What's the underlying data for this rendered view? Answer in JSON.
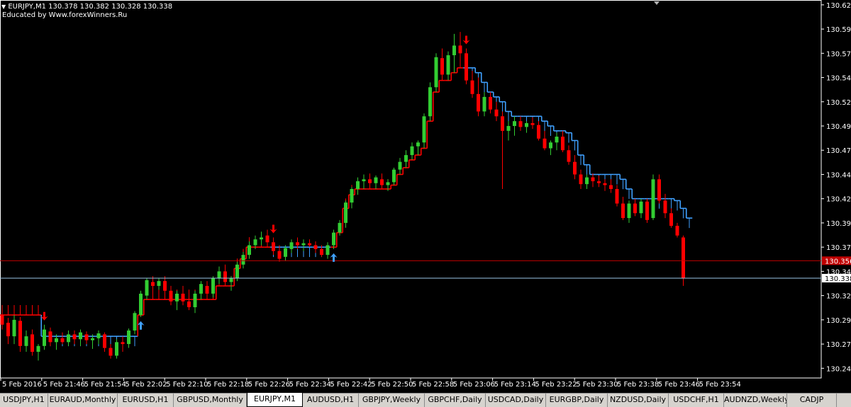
{
  "header": {
    "title": "EURJPY,M1  130.378 130.382 130.328 130.338",
    "subtitle": "Educated by Www.forexWinners.Ru"
  },
  "price_axis": {
    "labels": [
      "130.620",
      "130.595",
      "130.570",
      "130.545",
      "130.520",
      "130.495",
      "130.470",
      "130.445",
      "130.420",
      "130.395",
      "130.370",
      "130.345",
      "130.320",
      "130.295",
      "130.270",
      "130.245"
    ],
    "bid_line_label": "130.338",
    "red_line_label": "130.356"
  },
  "time_axis": {
    "labels": [
      "5 Feb 2016",
      "5 Feb 21:46",
      "5 Feb 21:54",
      "5 Feb 22:02",
      "5 Feb 22:10",
      "5 Feb 22:18",
      "5 Feb 22:26",
      "5 Feb 22:34",
      "5 Feb 22:42",
      "5 Feb 22:50",
      "5 Feb 22:58",
      "5 Feb 23:06",
      "5 Feb 23:14",
      "5 Feb 23:22",
      "5 Feb 23:30",
      "5 Feb 23:38",
      "5 Feb 23:46",
      "5 Feb 23:54"
    ]
  },
  "colors": {
    "background": "#000000",
    "bull_candle": "#32cd32",
    "bear_candle": "#ff0000",
    "trail_up": "#3fa0ff",
    "trail_down": "#ff0000",
    "bid_line": "#9ac6e8",
    "red_line": "#c00000",
    "axis": "#ffffff"
  },
  "chart_data": {
    "type": "candlestick",
    "symbol": "EURJPY",
    "timeframe": "M1",
    "ylim": [
      130.235,
      130.625
    ],
    "candles": [
      [
        130.3,
        130.306,
        130.285,
        130.29
      ],
      [
        130.292,
        130.297,
        130.27,
        130.278
      ],
      [
        130.278,
        130.3,
        130.27,
        130.295
      ],
      [
        130.294,
        130.298,
        130.262,
        130.268
      ],
      [
        130.268,
        130.284,
        130.262,
        130.278
      ],
      [
        130.28,
        130.285,
        130.258,
        130.262
      ],
      [
        130.262,
        130.27,
        130.253,
        130.268
      ],
      [
        130.268,
        130.29,
        130.264,
        130.285
      ],
      [
        130.283,
        130.287,
        130.268,
        130.272
      ],
      [
        130.272,
        130.28,
        130.264,
        130.276
      ],
      [
        130.276,
        130.282,
        130.27,
        130.272
      ],
      [
        130.272,
        130.284,
        130.268,
        130.28
      ],
      [
        130.28,
        130.284,
        130.27,
        130.275
      ],
      [
        130.275,
        130.285,
        130.268,
        130.282
      ],
      [
        130.28,
        130.283,
        130.27,
        130.274
      ],
      [
        130.274,
        130.28,
        130.265,
        130.276
      ],
      [
        130.276,
        130.284,
        130.27,
        130.281
      ],
      [
        130.28,
        130.282,
        130.262,
        130.266
      ],
      [
        130.266,
        130.27,
        130.255,
        130.258
      ],
      [
        130.258,
        130.275,
        130.255,
        130.272
      ],
      [
        130.272,
        130.278,
        130.262,
        130.27
      ],
      [
        130.27,
        130.286,
        130.266,
        130.284
      ],
      [
        130.284,
        130.304,
        130.28,
        130.302
      ],
      [
        130.3,
        130.325,
        130.298,
        130.322
      ],
      [
        130.32,
        130.338,
        130.316,
        130.336
      ],
      [
        130.334,
        130.34,
        130.325,
        130.33
      ],
      [
        130.33,
        130.338,
        130.326,
        130.335
      ],
      [
        130.335,
        130.34,
        130.32,
        130.325
      ],
      [
        130.325,
        130.33,
        130.31,
        130.314
      ],
      [
        130.314,
        130.325,
        130.305,
        130.322
      ],
      [
        130.322,
        130.33,
        130.31,
        130.314
      ],
      [
        130.314,
        130.32,
        130.305,
        130.308
      ],
      [
        130.308,
        130.325,
        130.302,
        130.322
      ],
      [
        130.322,
        130.335,
        130.316,
        130.332
      ],
      [
        130.33,
        130.335,
        130.318,
        130.322
      ],
      [
        130.322,
        130.34,
        130.318,
        130.338
      ],
      [
        130.338,
        130.35,
        130.332,
        130.345
      ],
      [
        130.345,
        130.352,
        130.33,
        130.334
      ],
      [
        130.334,
        130.34,
        130.325,
        130.338
      ],
      [
        130.338,
        130.355,
        130.335,
        130.352
      ],
      [
        130.352,
        130.365,
        130.348,
        130.362
      ],
      [
        130.362,
        130.376,
        130.358,
        130.372
      ],
      [
        130.372,
        130.382,
        130.368,
        130.378
      ],
      [
        130.378,
        130.386,
        130.372,
        130.38
      ],
      [
        130.382,
        130.388,
        130.372,
        130.375
      ],
      [
        130.375,
        130.38,
        130.362,
        130.366
      ],
      [
        130.366,
        130.372,
        130.355,
        130.358
      ],
      [
        130.36,
        130.372,
        130.356,
        130.369
      ],
      [
        130.368,
        130.378,
        130.364,
        130.375
      ],
      [
        130.375,
        130.38,
        130.368,
        130.372
      ],
      [
        130.372,
        130.378,
        130.366,
        130.374
      ],
      [
        130.374,
        130.378,
        130.37,
        130.372
      ],
      [
        130.372,
        130.376,
        130.364,
        130.368
      ],
      [
        130.368,
        130.372,
        130.36,
        130.362
      ],
      [
        130.362,
        130.375,
        130.358,
        130.372
      ],
      [
        130.372,
        130.388,
        130.368,
        130.385
      ],
      [
        130.385,
        130.398,
        130.382,
        130.395
      ],
      [
        130.395,
        130.418,
        130.39,
        130.416
      ],
      [
        130.416,
        130.432,
        130.41,
        130.43
      ],
      [
        130.43,
        130.442,
        130.424,
        130.438
      ],
      [
        130.438,
        130.445,
        130.43,
        130.44
      ],
      [
        130.44,
        130.446,
        130.432,
        130.436
      ],
      [
        130.436,
        130.444,
        130.43,
        130.442
      ],
      [
        130.44,
        130.446,
        130.43,
        130.434
      ],
      [
        130.434,
        130.44,
        130.428,
        130.437
      ],
      [
        130.437,
        130.452,
        130.434,
        130.45
      ],
      [
        130.45,
        130.462,
        130.445,
        130.458
      ],
      [
        130.458,
        130.47,
        130.452,
        130.465
      ],
      [
        130.465,
        130.478,
        130.46,
        130.474
      ],
      [
        130.474,
        130.48,
        130.465,
        130.478
      ],
      [
        130.478,
        130.508,
        130.472,
        130.505
      ],
      [
        130.505,
        130.54,
        130.5,
        130.535
      ],
      [
        130.535,
        130.57,
        130.53,
        130.566
      ],
      [
        130.565,
        130.575,
        130.542,
        130.548
      ],
      [
        130.548,
        130.572,
        130.542,
        130.568
      ],
      [
        130.568,
        130.59,
        130.55,
        130.578
      ],
      [
        130.578,
        130.592,
        130.565,
        130.57
      ],
      [
        130.57,
        130.575,
        130.538,
        130.542
      ],
      [
        130.542,
        130.552,
        130.524,
        130.528
      ],
      [
        130.528,
        130.545,
        130.505,
        130.51
      ],
      [
        130.51,
        130.53,
        130.505,
        130.525
      ],
      [
        130.525,
        130.53,
        130.508,
        130.512
      ],
      [
        130.512,
        130.52,
        130.5,
        130.505
      ],
      [
        130.505,
        130.51,
        130.43,
        130.49
      ],
      [
        130.49,
        130.5,
        130.48,
        130.495
      ],
      [
        130.495,
        130.505,
        130.485,
        130.5
      ],
      [
        130.5,
        130.505,
        130.49,
        130.494
      ],
      [
        130.494,
        130.5,
        130.488,
        130.498
      ],
      [
        130.498,
        130.504,
        130.492,
        130.496
      ],
      [
        130.496,
        130.5,
        130.48,
        130.482
      ],
      [
        130.482,
        130.49,
        130.47,
        130.472
      ],
      [
        130.472,
        130.48,
        130.465,
        130.478
      ],
      [
        130.478,
        130.488,
        130.47,
        130.484
      ],
      [
        130.484,
        130.49,
        130.468,
        130.47
      ],
      [
        130.47,
        130.475,
        130.455,
        130.458
      ],
      [
        130.458,
        130.465,
        130.44,
        130.445
      ],
      [
        130.445,
        130.45,
        130.43,
        130.435
      ],
      [
        130.435,
        130.445,
        130.43,
        130.442
      ],
      [
        130.442,
        130.446,
        130.432,
        130.438
      ],
      [
        130.438,
        130.444,
        130.432,
        130.436
      ],
      [
        130.436,
        130.44,
        130.428,
        130.434
      ],
      [
        130.434,
        130.44,
        130.426,
        130.43
      ],
      [
        130.43,
        130.434,
        130.412,
        130.415
      ],
      [
        130.415,
        130.422,
        130.398,
        130.4
      ],
      [
        130.4,
        130.418,
        130.395,
        130.415
      ],
      [
        130.415,
        130.42,
        130.402,
        130.405
      ],
      [
        130.405,
        130.42,
        130.4,
        130.417
      ],
      [
        130.417,
        130.42,
        130.395,
        130.398
      ],
      [
        130.4,
        130.445,
        130.398,
        130.44
      ],
      [
        130.44,
        130.445,
        130.415,
        130.418
      ],
      [
        130.418,
        130.425,
        130.4,
        130.405
      ],
      [
        130.405,
        130.41,
        130.39,
        130.392
      ],
      [
        130.392,
        130.395,
        130.38,
        130.382
      ],
      [
        130.38,
        130.382,
        130.33,
        130.338
      ]
    ],
    "trail": [
      130.3,
      130.3,
      130.3,
      130.3,
      130.3,
      130.3,
      130.3,
      130.278,
      130.278,
      130.278,
      130.278,
      130.278,
      130.278,
      130.278,
      130.278,
      130.278,
      130.278,
      130.278,
      130.278,
      130.278,
      130.278,
      130.278,
      130.278,
      130.3,
      130.316,
      130.316,
      130.316,
      130.316,
      130.316,
      130.316,
      130.316,
      130.316,
      130.316,
      130.316,
      130.316,
      130.316,
      130.33,
      130.33,
      130.33,
      130.348,
      130.358,
      130.37,
      130.37,
      130.37,
      130.37,
      130.37,
      130.37,
      130.37,
      130.37,
      130.37,
      130.37,
      130.37,
      130.37,
      130.37,
      130.37,
      130.37,
      130.385,
      130.41,
      130.424,
      130.43,
      130.43,
      130.43,
      130.43,
      130.43,
      130.43,
      130.434,
      130.445,
      130.452,
      130.46,
      130.465,
      130.472,
      130.5,
      130.53,
      130.542,
      130.542,
      130.55,
      130.555,
      130.555,
      130.555,
      130.55,
      130.54,
      130.53,
      130.525,
      130.52,
      130.51,
      130.505,
      130.505,
      130.505,
      130.505,
      130.505,
      130.5,
      130.495,
      130.49,
      130.49,
      130.488,
      130.48,
      130.465,
      130.455,
      130.445,
      130.445,
      130.445,
      130.445,
      130.445,
      130.44,
      130.43,
      130.42,
      130.42,
      130.42,
      130.42,
      130.42,
      130.42,
      130.42,
      130.418,
      130.41,
      130.4
    ],
    "trail_dir": [
      -1,
      -1,
      -1,
      -1,
      -1,
      -1,
      -1,
      1,
      1,
      1,
      1,
      1,
      1,
      1,
      1,
      1,
      1,
      1,
      1,
      1,
      1,
      1,
      1,
      -1,
      -1,
      -1,
      -1,
      -1,
      -1,
      -1,
      -1,
      -1,
      -1,
      -1,
      -1,
      -1,
      -1,
      -1,
      -1,
      -1,
      -1,
      -1,
      -1,
      -1,
      -1,
      1,
      1,
      1,
      1,
      1,
      1,
      1,
      1,
      1,
      1,
      -1,
      -1,
      -1,
      -1,
      -1,
      -1,
      -1,
      -1,
      -1,
      -1,
      -1,
      -1,
      -1,
      -1,
      -1,
      -1,
      -1,
      -1,
      -1,
      -1,
      -1,
      -1,
      1,
      1,
      1,
      1,
      1,
      1,
      1,
      1,
      1,
      1,
      1,
      1,
      1,
      1,
      1,
      1,
      1,
      1,
      1,
      1,
      1,
      1,
      1,
      1,
      1,
      1,
      1,
      1,
      1,
      1,
      1,
      1,
      1,
      1,
      1,
      1,
      1,
      1,
      1
    ],
    "signals": [
      {
        "type": "sell",
        "index": 7
      },
      {
        "type": "buy",
        "index": 23
      },
      {
        "type": "sell",
        "index": 45
      },
      {
        "type": "buy",
        "index": 55
      },
      {
        "type": "sell",
        "index": 77
      }
    ],
    "hlines": [
      {
        "name": "red-line",
        "value": 130.356
      },
      {
        "name": "bid-line",
        "value": 130.338
      }
    ]
  },
  "tabs": [
    {
      "label": "USDJPY,H1"
    },
    {
      "label": "EURAUD,Monthly"
    },
    {
      "label": "EURUSD,H1"
    },
    {
      "label": "GBPUSD,Monthly"
    },
    {
      "label": "EURJPY,M1",
      "active": true
    },
    {
      "label": "AUDUSD,H1"
    },
    {
      "label": "GBPJPY,Weekly"
    },
    {
      "label": "GBPCHF,Daily"
    },
    {
      "label": "USDCAD,Daily"
    },
    {
      "label": "EURGBP,Daily"
    },
    {
      "label": "NZDUSD,Daily"
    },
    {
      "label": "USDCHF,H1"
    },
    {
      "label": "AUDNZD,Weekly"
    },
    {
      "label": "CADJP"
    }
  ]
}
